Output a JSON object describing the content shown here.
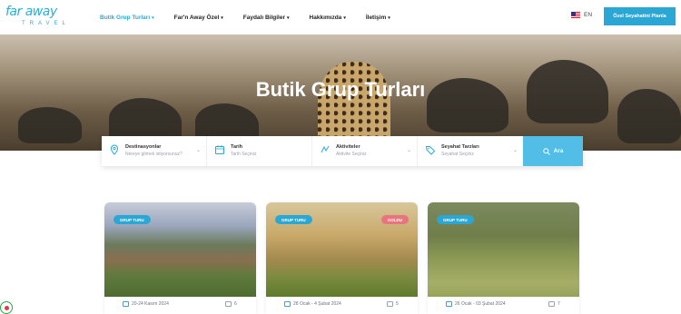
{
  "brand": {
    "name": "far away",
    "sub": "TRAVEL"
  },
  "nav": {
    "items": [
      {
        "label": "Butik Grup Turları",
        "caret": "▾"
      },
      {
        "label": "Far'n Away Özel",
        "caret": "▾"
      },
      {
        "label": "Faydalı Bilgiler",
        "caret": "▾"
      },
      {
        "label": "Hakkımızda",
        "caret": "▾"
      },
      {
        "label": "İletişim",
        "caret": "▾"
      }
    ]
  },
  "lang": {
    "code": "EN"
  },
  "cta": {
    "label": "Özel Seyahatini Planla"
  },
  "hero": {
    "title": "Butik Grup Turları"
  },
  "search": {
    "fields": [
      {
        "label": "Destinasyonlar",
        "placeholder": "Nereye gitmek istiyorsunuz?",
        "icon": "location-pin-icon"
      },
      {
        "label": "Tarih",
        "placeholder": "Tarih Seçiniz",
        "icon": "calendar-icon"
      },
      {
        "label": "Aktiviteler",
        "placeholder": "Aktivite Seçiniz",
        "icon": "activity-icon"
      },
      {
        "label": "Seyahat Tarzları",
        "placeholder": "Seyahat Seçiniz",
        "icon": "tag-icon"
      }
    ],
    "button": "Ara"
  },
  "cards": [
    {
      "badge": "GRUP TURU",
      "status": "",
      "date": "20-24 Kasım 2024",
      "count": "6"
    },
    {
      "badge": "GRUP TURU",
      "status": "DOLDU",
      "date": "28 Ocak - 4 Şubat 2024",
      "count": "5"
    },
    {
      "badge": "GRUP TURU",
      "status": "",
      "date": "26 Ocak - 03 Şubat 2024",
      "count": "7"
    }
  ],
  "colors": {
    "accent": "#2ba7d6",
    "full": "#e9747d"
  }
}
